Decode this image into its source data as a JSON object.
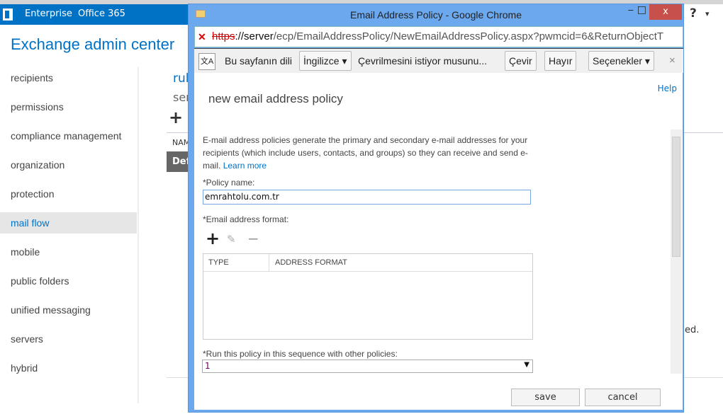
{
  "topbar": {
    "tabs": [
      "Enterprise",
      "Office 365"
    ],
    "help": "?",
    "help_caret": "▾"
  },
  "app_title": "Exchange admin center",
  "nav": [
    "recipients",
    "permissions",
    "compliance management",
    "organization",
    "protection",
    "mail flow",
    "mobile",
    "public folders",
    "unified messaging",
    "servers",
    "hybrid"
  ],
  "nav_selected": "mail flow",
  "background": {
    "tab1": "rul",
    "tab2": "ser",
    "add": "+",
    "col": "NAM",
    "row": "Def",
    "trail": "ed."
  },
  "window": {
    "title": "Email Address Policy - Google Chrome",
    "minimize": "‒",
    "maximize": "□",
    "close": "x",
    "url_scheme": "https",
    "url_host": "://server",
    "url_path": "/ecp/EmailAddressPolicy/NewEmailAddressPolicy.aspx?pwmcid=6&ReturnObjectT"
  },
  "translate": {
    "prefix": "Bu sayfanın dili",
    "language": "İngilizce",
    "question": "Çevrilmesini istiyor musunu...",
    "translate": "Çevir",
    "no": "Hayır",
    "options": "Seçenekler",
    "close": "×"
  },
  "form": {
    "help": "Help",
    "title": "new email address policy",
    "description": "E-mail address policies generate the primary and secondary e-mail addresses for your recipients (which include users, contacts, and groups) so they can receive and send e-mail.",
    "learn_more": "Learn more",
    "policy_name_label": "*Policy name:",
    "policy_name_value": "emrahtolu.com.tr",
    "format_label": "*Email address format:",
    "columns": [
      "TYPE",
      "ADDRESS FORMAT"
    ],
    "sequence_label": "*Run this policy in this sequence with other policies:",
    "sequence_value": "1",
    "save": "save",
    "cancel": "cancel"
  },
  "colors": {
    "brand": "#0072c6",
    "window": "#6ba8ee",
    "close": "#c7504b"
  }
}
